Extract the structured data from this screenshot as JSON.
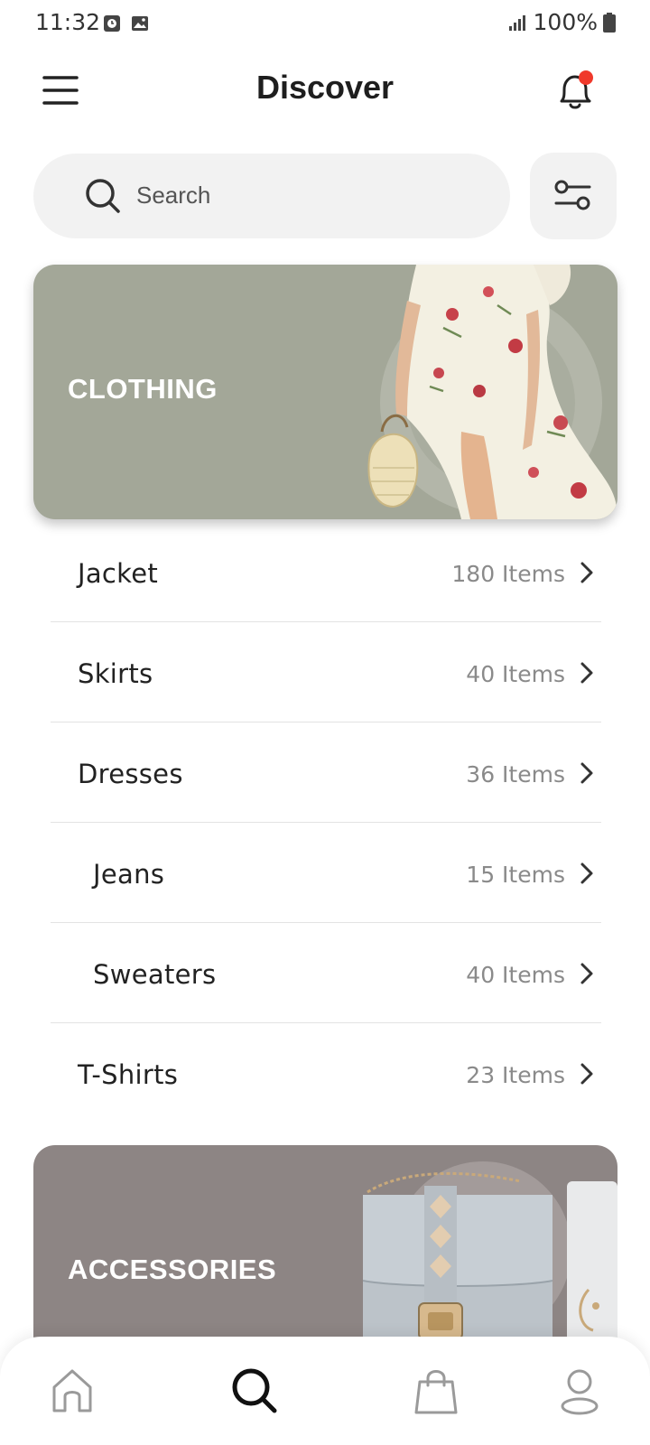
{
  "status_bar": {
    "time": "11:32",
    "battery": "100%",
    "icons": [
      "clock-notification-icon",
      "image-notification-icon",
      "signal-icon",
      "battery-icon"
    ]
  },
  "header": {
    "title": "Discover",
    "menu_icon": "hamburger-menu-icon",
    "notification_icon": "bell-icon",
    "notification_badge_color": "#f0392b"
  },
  "search": {
    "placeholder": "Search",
    "icon": "search-icon",
    "filter_icon": "sliders-filter-icon"
  },
  "banners": {
    "clothing": {
      "label": "CLOTHING",
      "color": "#a3a798"
    },
    "accessories": {
      "label": "ACCESSORIES",
      "color": "#8d8584"
    }
  },
  "categories": [
    {
      "name": "Jacket",
      "count": "180 Items"
    },
    {
      "name": "Skirts",
      "count": "40 Items"
    },
    {
      "name": "Dresses",
      "count": "36 Items"
    },
    {
      "name": "Jeans",
      "count": "15 Items"
    },
    {
      "name": "Sweaters",
      "count": "40 Items"
    },
    {
      "name": "T-Shirts",
      "count": "23 Items"
    }
  ],
  "bottom_nav": {
    "items": [
      "home-icon",
      "search-icon",
      "shopping-bag-icon",
      "profile-icon"
    ],
    "active": "search-icon"
  }
}
